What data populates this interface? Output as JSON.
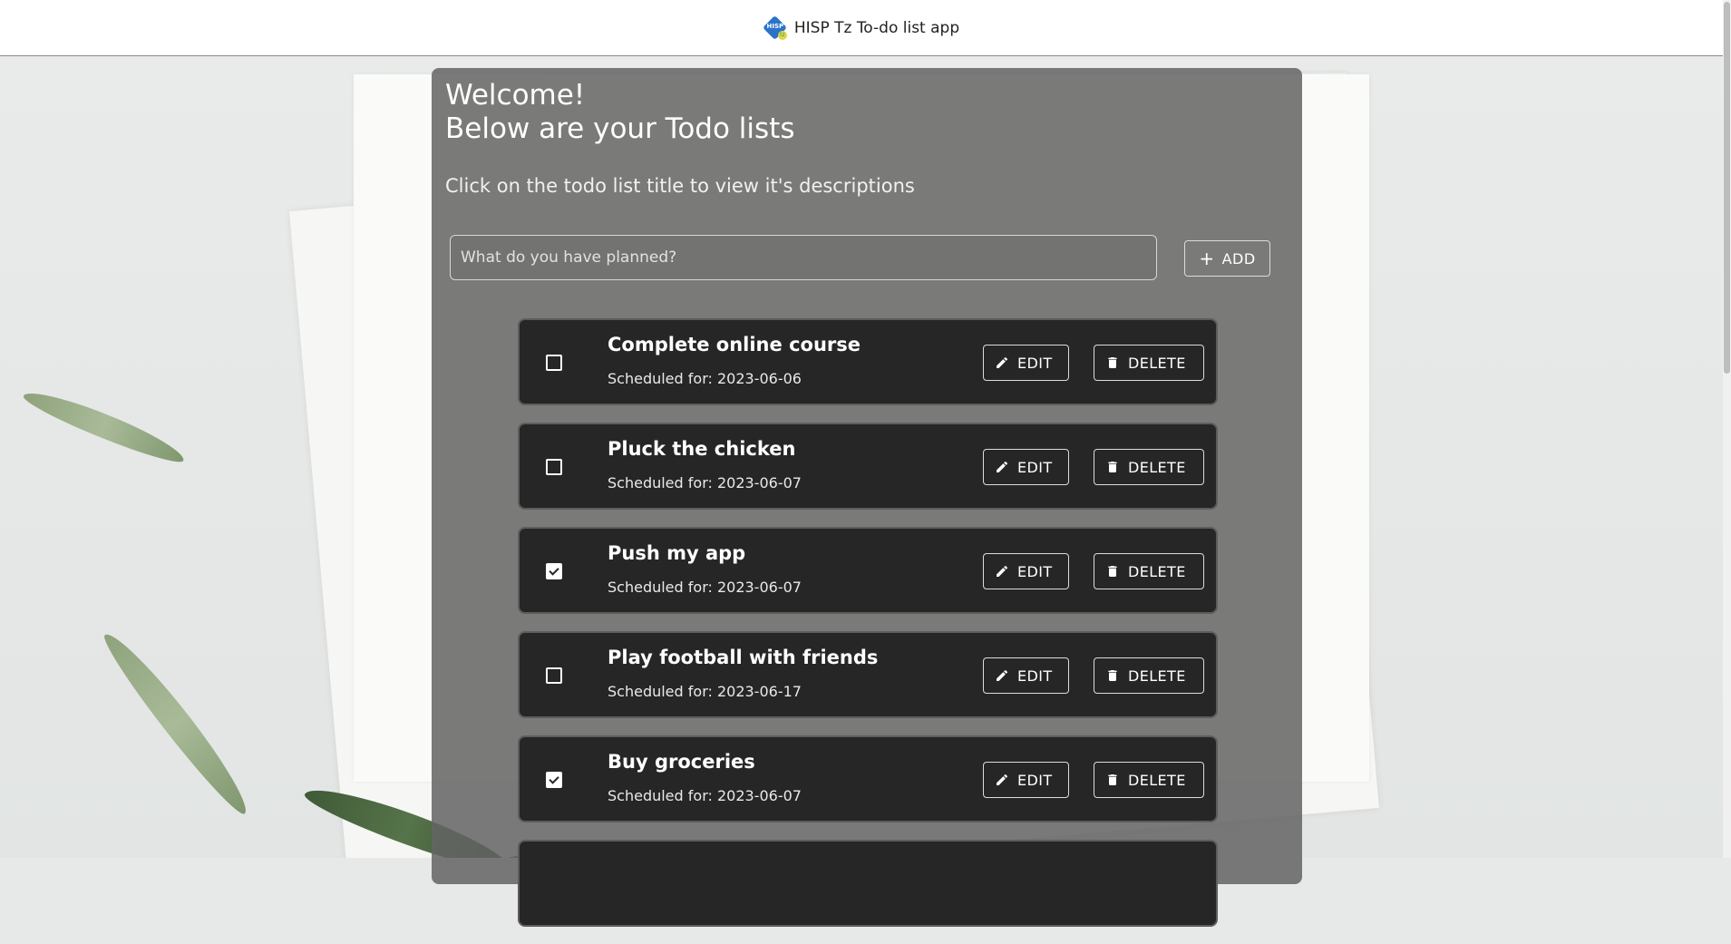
{
  "header": {
    "app_title": "HISP Tz To-do list app",
    "logo_text": "HISP",
    "logo_badge": "tz"
  },
  "panel": {
    "welcome_line1": "Welcome!",
    "welcome_line2": "Below are your Todo lists",
    "hint": "Click on the todo list title to view it's descriptions",
    "search_placeholder": "What do you have planned?",
    "add_label": "ADD"
  },
  "todos": [
    {
      "title": "Complete online course",
      "scheduled": "Scheduled for: 2023-06-06",
      "completed": false,
      "edit_label": "EDIT",
      "delete_label": "DELETE"
    },
    {
      "title": "Pluck the chicken",
      "scheduled": "Scheduled for: 2023-06-07",
      "completed": false,
      "edit_label": "EDIT",
      "delete_label": "DELETE"
    },
    {
      "title": "Push my app",
      "scheduled": "Scheduled for: 2023-06-07",
      "completed": true,
      "edit_label": "EDIT",
      "delete_label": "DELETE"
    },
    {
      "title": "Play football with friends",
      "scheduled": "Scheduled for: 2023-06-17",
      "completed": false,
      "edit_label": "EDIT",
      "delete_label": "DELETE"
    },
    {
      "title": "Buy groceries",
      "scheduled": "Scheduled for: 2023-06-07",
      "completed": true,
      "edit_label": "EDIT",
      "delete_label": "DELETE"
    }
  ],
  "colors": {
    "panel": "#646464",
    "card": "#262626",
    "logo_blue": "#2a73c9"
  },
  "icons": {
    "add": "plus-icon",
    "edit": "pencil-icon",
    "delete": "trash-icon"
  }
}
